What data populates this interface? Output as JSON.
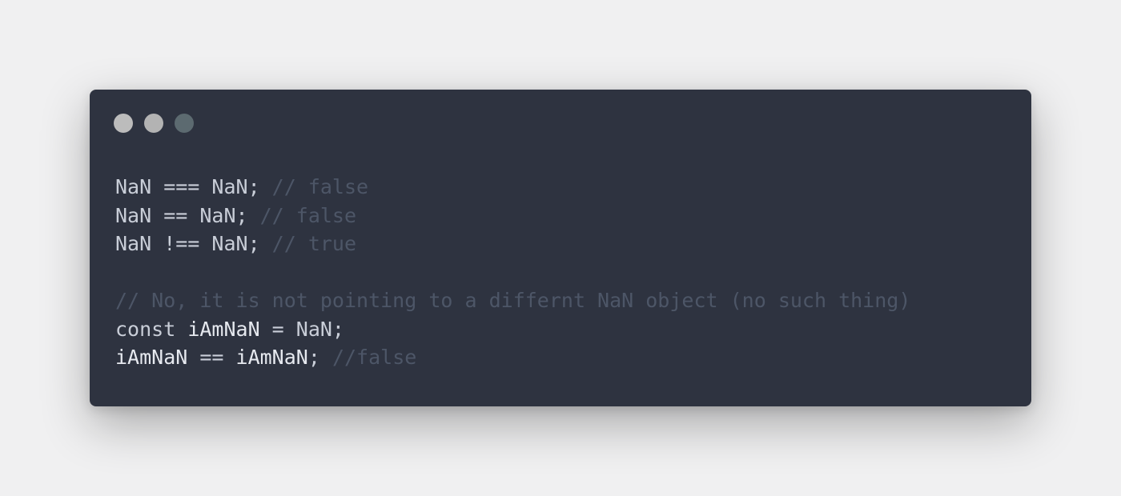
{
  "window_controls": {
    "dots": [
      {
        "name": "close-dot",
        "color": "#bcbcbc"
      },
      {
        "name": "minimize-dot",
        "color": "#b3b3b3"
      },
      {
        "name": "maximize-dot",
        "color": "#5c6a70"
      }
    ]
  },
  "colors": {
    "page_background": "#f0f0f1",
    "window_background": "#2e3340",
    "code_text": "#c9ced8",
    "comment_text": "#4d5667"
  },
  "code_lines": [
    [
      {
        "type": "plain",
        "text": "NaN === NaN; "
      },
      {
        "type": "comment",
        "text": "// false"
      }
    ],
    [
      {
        "type": "plain",
        "text": "NaN == NaN; "
      },
      {
        "type": "comment",
        "text": "// false"
      }
    ],
    [
      {
        "type": "plain",
        "text": "NaN !== NaN; "
      },
      {
        "type": "comment",
        "text": "// true"
      }
    ],
    [],
    [
      {
        "type": "comment",
        "text": "// No, it is not pointing to a differnt NaN object (no such thing)"
      }
    ],
    [
      {
        "type": "keyword",
        "text": "const "
      },
      {
        "type": "ident",
        "text": "iAmNaN"
      },
      {
        "type": "plain",
        "text": " = NaN;"
      }
    ],
    [
      {
        "type": "ident",
        "text": "iAmNaN"
      },
      {
        "type": "plain",
        "text": " == "
      },
      {
        "type": "ident",
        "text": "iAmNaN"
      },
      {
        "type": "plain",
        "text": "; "
      },
      {
        "type": "comment",
        "text": "//false"
      }
    ]
  ]
}
